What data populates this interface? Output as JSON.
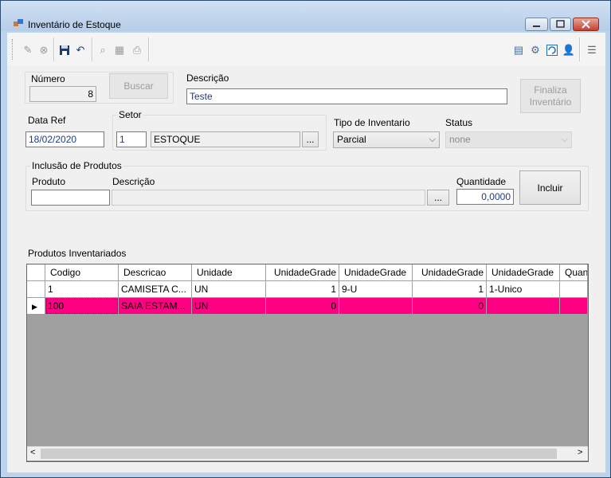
{
  "window": {
    "title": "Inventário de Estoque",
    "controls": [
      "minimize",
      "maximize",
      "close"
    ]
  },
  "toolbar": {
    "left_icons": [
      "new-icon",
      "cancel-icon",
      "save-icon",
      "undo-icon",
      "search-icon",
      "filter-icon",
      "print-icon"
    ],
    "right_icons": [
      "card-icon",
      "gears-icon",
      "refresh-icon",
      "user-icon",
      "menu-icon"
    ]
  },
  "form": {
    "numero_label": "Número",
    "numero_value": "8",
    "buscar_label": "Buscar",
    "descricao_label": "Descrição",
    "descricao_value": "Teste",
    "finaliza_line1": "Finaliza",
    "finaliza_line2": "Inventário",
    "data_ref_label": "Data Ref",
    "data_ref_value": "18/02/2020",
    "setor_label": "Setor",
    "setor_code": "1",
    "setor_name": "ESTOQUE",
    "setor_lookup": "...",
    "tipo_label": "Tipo de Inventario",
    "tipo_value": "Parcial",
    "status_label": "Status",
    "status_value": "none"
  },
  "inclusao": {
    "title": "Inclusão de Produtos",
    "produto_label": "Produto",
    "produto_value": "",
    "descricao_label": "Descrição",
    "descricao_value": "",
    "lookup": "...",
    "quantidade_label": "Quantidade",
    "quantidade_value": "0,0000",
    "incluir_label": "Incluir"
  },
  "grid": {
    "title": "Produtos Inventariados",
    "columns": [
      "Codigo",
      "Descricao",
      "Unidade",
      "UnidadeGrade",
      "UnidadeGrade",
      "UnidadeGrade",
      "UnidadeGrade",
      "Quan"
    ],
    "rows": [
      [
        "1",
        "CAMISETA C...",
        "UN",
        "1",
        "9-U",
        "1",
        "1-Unico",
        ""
      ],
      [
        "100",
        "SAIA ESTAM...",
        "UN",
        "0",
        "",
        "0",
        "",
        ""
      ]
    ],
    "row2_color": "#ff0084",
    "scroll_left": "<",
    "scroll_right": ">"
  }
}
